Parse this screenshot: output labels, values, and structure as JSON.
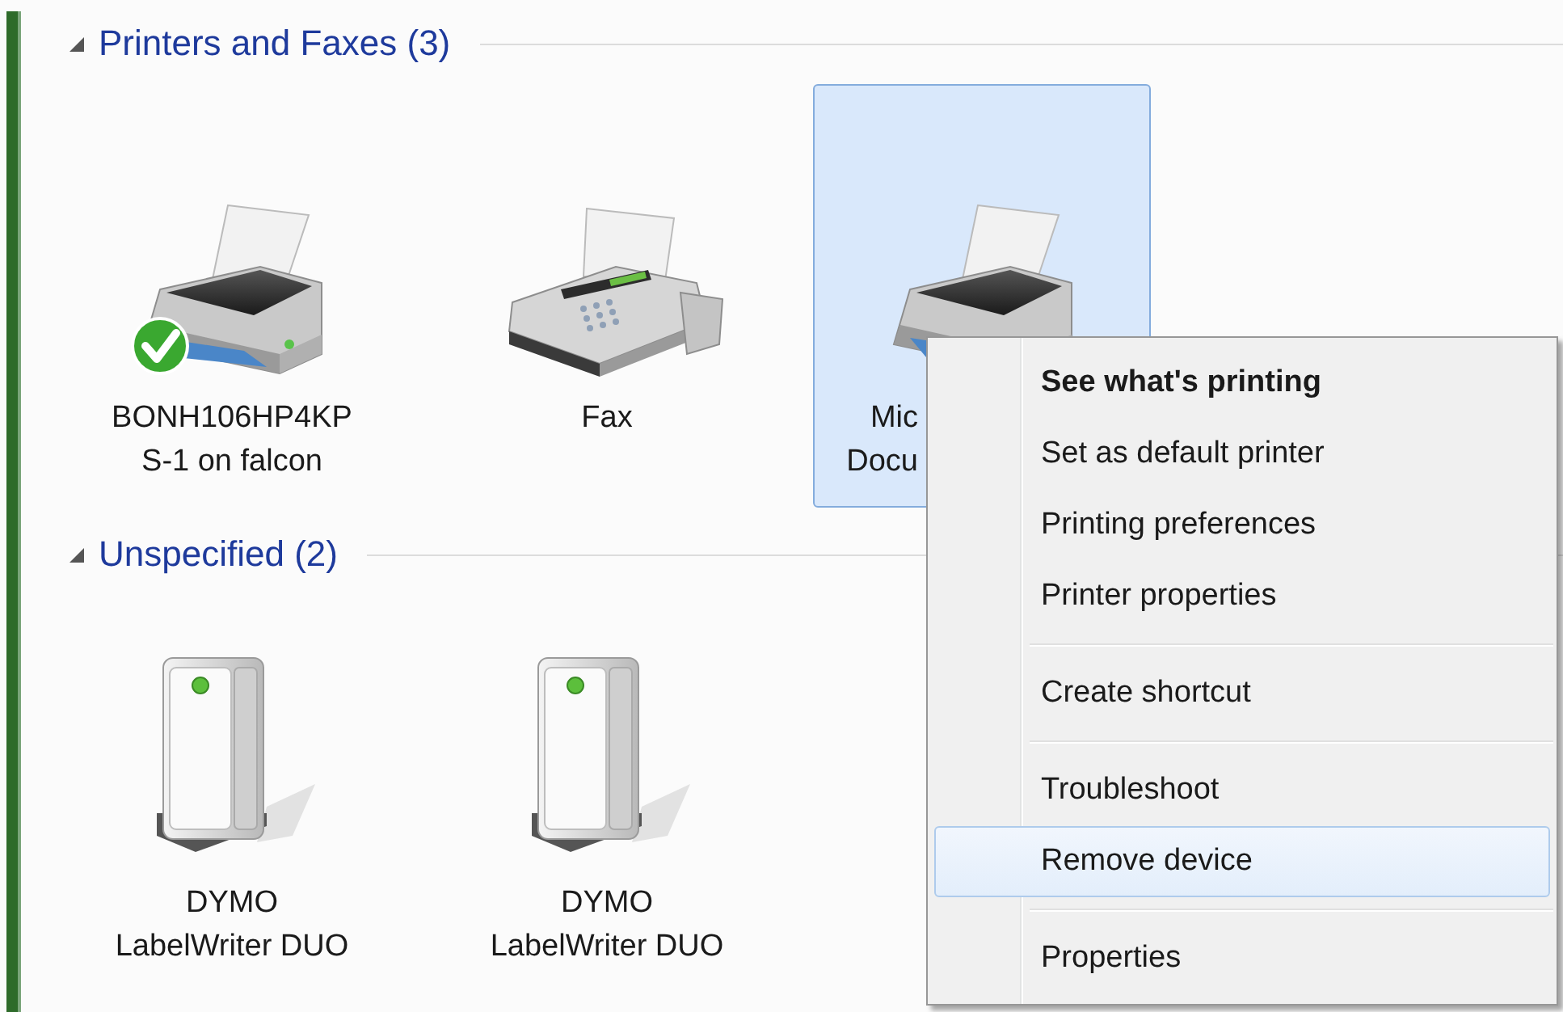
{
  "groups": [
    {
      "title": "Printers and Faxes (3)",
      "expanded": true,
      "devices": [
        {
          "kind": "printer",
          "label": [
            "BONH106HP4KP",
            "S-1 on falcon"
          ],
          "default": true,
          "selected": false,
          "label_covered": false
        },
        {
          "kind": "fax",
          "label": [
            "Fax"
          ],
          "default": false,
          "selected": false,
          "label_covered": false
        },
        {
          "kind": "printer",
          "label": [
            "Mic",
            "Docu"
          ],
          "default": false,
          "selected": true,
          "label_covered": true
        }
      ]
    },
    {
      "title": "Unspecified (2)",
      "expanded": true,
      "devices": [
        {
          "kind": "device",
          "label": [
            "DYMO",
            "LabelWriter DUO"
          ],
          "default": false,
          "selected": false,
          "label_covered": false
        },
        {
          "kind": "device",
          "label": [
            "DYMO",
            "LabelWriter DUO"
          ],
          "default": false,
          "selected": false,
          "label_covered": false
        }
      ]
    }
  ],
  "context_menu": {
    "items": [
      {
        "kind": "item",
        "label": "See what's printing",
        "bold": true,
        "selected": false
      },
      {
        "kind": "item",
        "label": "Set as default printer",
        "bold": false,
        "selected": false
      },
      {
        "kind": "item",
        "label": "Printing preferences",
        "bold": false,
        "selected": false
      },
      {
        "kind": "item",
        "label": "Printer properties",
        "bold": false,
        "selected": false
      },
      {
        "kind": "separator"
      },
      {
        "kind": "item",
        "label": "Create shortcut",
        "bold": false,
        "selected": false
      },
      {
        "kind": "separator"
      },
      {
        "kind": "item",
        "label": "Troubleshoot",
        "bold": false,
        "selected": false
      },
      {
        "kind": "item",
        "label": "Remove device",
        "bold": false,
        "selected": true
      },
      {
        "kind": "separator"
      },
      {
        "kind": "item",
        "label": "Properties",
        "bold": false,
        "selected": false
      }
    ]
  }
}
